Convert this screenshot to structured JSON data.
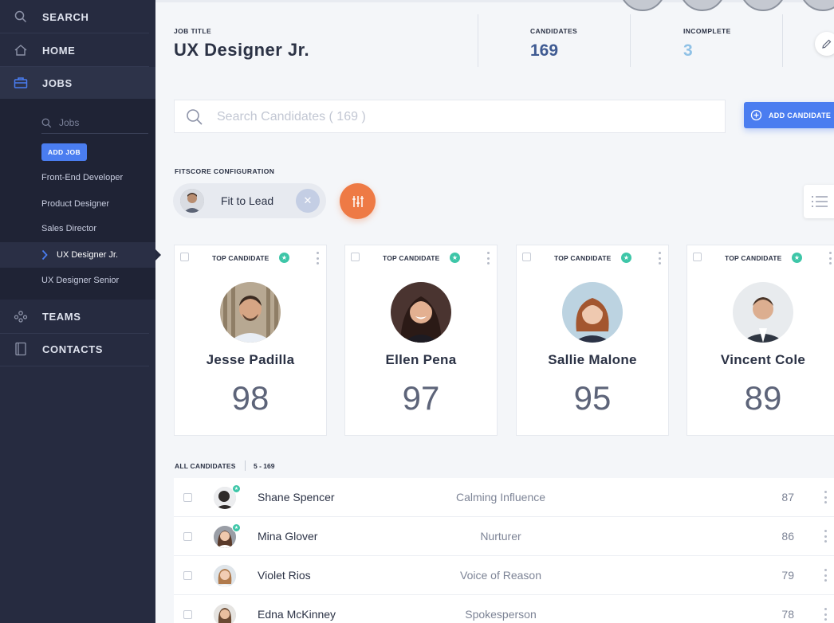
{
  "sidebar": {
    "nav": {
      "search": "SEARCH",
      "home": "HOME",
      "jobs": "JOBS",
      "teams": "TEAMS",
      "contacts": "CONTACTS"
    },
    "jobs_search_placeholder": "Jobs",
    "add_job_label": "ADD JOB",
    "job_items": [
      "Front-End Developer",
      "Product Designer",
      "Sales Director",
      "UX Designer Jr.",
      "UX Designer Senior"
    ],
    "active_job": "UX Designer Jr."
  },
  "header": {
    "job_title_label": "JOB TITLE",
    "job_title": "UX Designer Jr.",
    "candidates_label": "CANDIDATES",
    "candidates_count": "169",
    "incomplete_label": "INCOMPLETE",
    "incomplete_count": "3"
  },
  "search": {
    "placeholder": "Search Candidates ( 169 )"
  },
  "add_candidate_label": "ADD CANDIDATE",
  "fitscore": {
    "label": "FITSCORE CONFIGURATION",
    "chip_label": "Fit to Lead"
  },
  "top_candidates": [
    {
      "badge": "TOP CANDIDATE",
      "name": "Jesse Padilla",
      "score": "98"
    },
    {
      "badge": "TOP CANDIDATE",
      "name": "Ellen Pena",
      "score": "97"
    },
    {
      "badge": "TOP CANDIDATE",
      "name": "Sallie Malone",
      "score": "95"
    },
    {
      "badge": "TOP CANDIDATE",
      "name": "Vincent Cole",
      "score": "89"
    }
  ],
  "all_candidates": {
    "label": "ALL CANDIDATES",
    "range": "5 - 169",
    "rows": [
      {
        "name": "Shane Spencer",
        "role": "Calming Influence",
        "score": "87",
        "starred": true
      },
      {
        "name": "Mina Glover",
        "role": "Nurturer",
        "score": "86",
        "starred": true
      },
      {
        "name": "Violet Rios",
        "role": "Voice of Reason",
        "score": "79",
        "starred": false
      },
      {
        "name": "Edna McKinney",
        "role": "Spokesperson",
        "score": "78",
        "starred": false
      }
    ]
  },
  "colors": {
    "sidebar_bg": "#262b40",
    "accent_blue": "#4a7df0",
    "accent_orange": "#ee7a45",
    "star_green": "#3ec6a8",
    "incomplete_blue": "#8fc1e6"
  },
  "icons": [
    "search-icon",
    "home-icon",
    "briefcase-icon",
    "teams-icon",
    "contacts-icon",
    "chevron-right-icon",
    "pencil-icon",
    "plus-circle-icon",
    "sliders-icon",
    "list-icon",
    "star-icon",
    "more-vertical-icon",
    "close-icon"
  ]
}
